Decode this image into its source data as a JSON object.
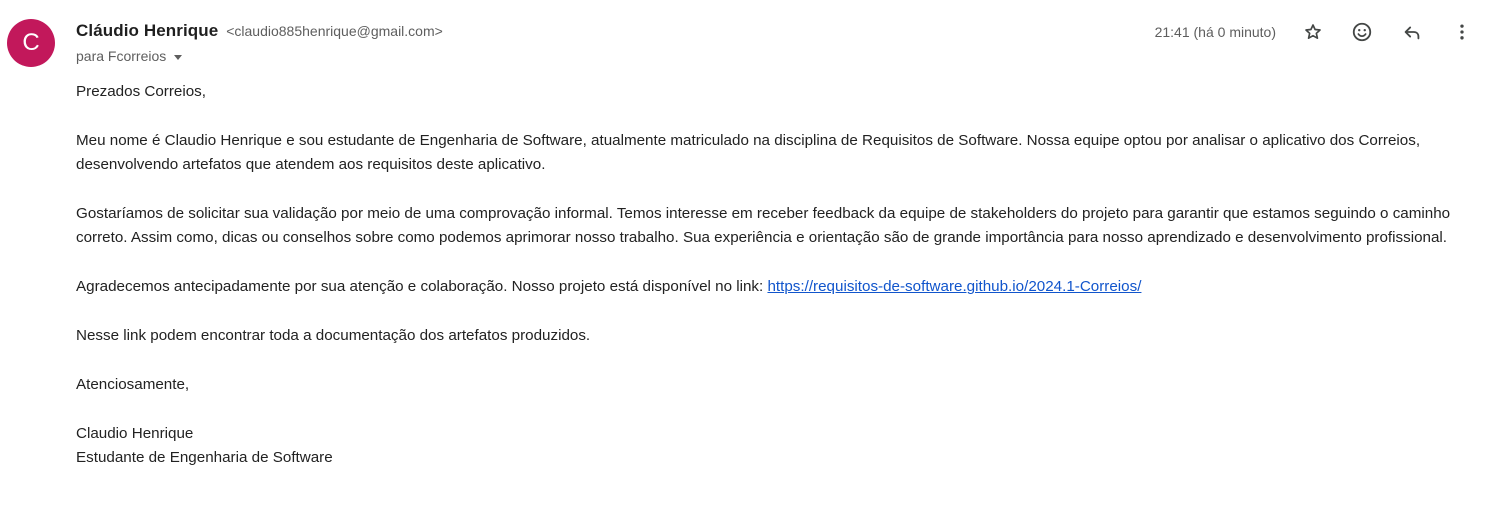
{
  "sender": {
    "avatar_letter": "C",
    "avatar_color": "#c2185b",
    "name": "Cláudio Henrique",
    "email": "<claudio885henrique@gmail.com>",
    "to_text": "para Fcorreios"
  },
  "timestamp": "21:41 (há 0 minuto)",
  "actions": {
    "star_icon": "star-icon",
    "emoji_icon": "emoji-icon",
    "reply_icon": "reply-icon",
    "more_icon": "more-vert-icon"
  },
  "body": {
    "greeting": "Prezados Correios,",
    "paragraph1": "Meu nome é Claudio Henrique e sou estudante de Engenharia de Software, atualmente matriculado na disciplina de Requisitos de Software. Nossa equipe optou por analisar o aplicativo dos Correios, desenvolvendo artefatos que atendem aos requisitos deste aplicativo.",
    "paragraph2": "Gostaríamos de solicitar sua validação por meio de uma comprovação informal. Temos interesse em receber feedback da equipe de stakeholders do projeto para garantir que estamos seguindo o caminho correto. Assim como, dicas ou conselhos sobre como podemos aprimorar nosso trabalho. Sua experiência e orientação são de grande importância para nosso aprendizado e desenvolvimento profissional.",
    "paragraph3_prefix": "Agradecemos antecipadamente por sua atenção e colaboração. Nosso projeto está disponível no link: ",
    "link_text": "https://requisitos-de-software.github.io/2024.1-Correios/",
    "link_color": "#1155cc",
    "paragraph4": "Nesse link podem encontrar toda a documentação dos artefatos produzidos.",
    "closing": "Atenciosamente,",
    "signature_name": "Claudio Henrique",
    "signature_title": "Estudante de Engenharia de Software"
  }
}
